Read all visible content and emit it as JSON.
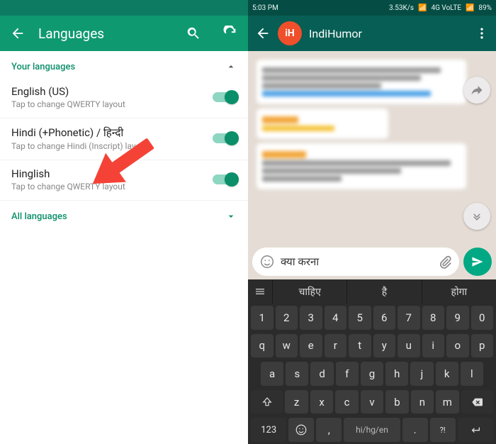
{
  "left": {
    "title": "Languages",
    "section_your": "Your languages",
    "section_all": "All languages",
    "items": [
      {
        "name": "English (US)",
        "sub": "Tap to change QWERTY layout"
      },
      {
        "name": "Hindi (+Phonetic) / हिन्दी",
        "sub": "Tap to change Hindi (Inscript) layout"
      },
      {
        "name": "Hinglish",
        "sub": "Tap to change QWERTY layout"
      }
    ]
  },
  "right": {
    "status": {
      "time": "5:03 PM",
      "speed": "3.53K/s",
      "net": "4G VoLTE",
      "battery": "89%"
    },
    "chat_title": "IndiHumor",
    "input_text": "क्या करना",
    "suggestions": [
      "चाहिए",
      "है",
      "होगा"
    ],
    "rows": {
      "r1": [
        "1",
        "2",
        "3",
        "4",
        "5",
        "6",
        "7",
        "8",
        "9",
        "0"
      ],
      "r2": [
        "q",
        "w",
        "e",
        "r",
        "t",
        "y",
        "u",
        "i",
        "o",
        "p"
      ],
      "r3": [
        "a",
        "s",
        "d",
        "f",
        "g",
        "h",
        "j",
        "k",
        "l"
      ],
      "r4_letters": [
        "z",
        "x",
        "c",
        "v",
        "b",
        "n",
        "m"
      ],
      "r5": {
        "numkey": "123",
        "comma": ",",
        "space": "hi/hg/en",
        "dot": ".",
        "qmark": "?!"
      }
    }
  }
}
